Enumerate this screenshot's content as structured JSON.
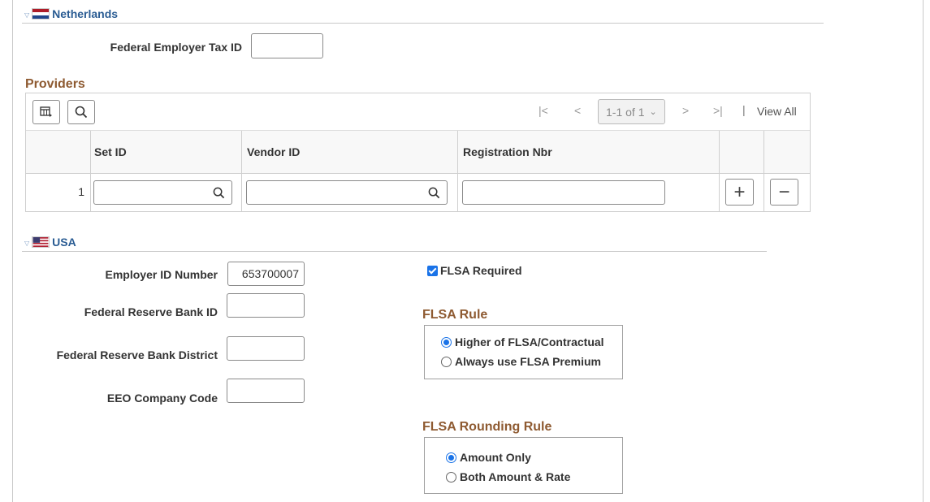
{
  "netherlands": {
    "title": "Netherlands",
    "fed_employer_tax_id_label": "Federal Employer Tax ID",
    "fed_employer_tax_id_value": ""
  },
  "providers": {
    "title": "Providers",
    "pager": {
      "range": "1-1 of 1",
      "view_all": "View All"
    },
    "columns": {
      "set_id": "Set ID",
      "vendor_id": "Vendor ID",
      "registration_nbr": "Registration Nbr"
    },
    "rows": [
      {
        "num": "1",
        "set_id": "",
        "vendor_id": "",
        "registration_nbr": ""
      }
    ],
    "add_symbol": "+",
    "delete_symbol": "−"
  },
  "usa": {
    "title": "USA",
    "employer_id_label": "Employer ID Number",
    "employer_id_value": "653700007",
    "frb_id_label": "Federal Reserve Bank ID",
    "frb_id_value": "",
    "frb_district_label": "Federal Reserve Bank District",
    "frb_district_value": "",
    "eeo_code_label": "EEO Company Code",
    "eeo_code_value": "",
    "flsa_required_label": "FLSA Required",
    "flsa_required_checked": true,
    "flsa_rule": {
      "title": "FLSA Rule",
      "options": [
        {
          "label": "Higher of FLSA/Contractual",
          "selected": true
        },
        {
          "label": "Always use FLSA Premium",
          "selected": false
        }
      ]
    },
    "flsa_rounding_rule": {
      "title": "FLSA Rounding Rule",
      "options": [
        {
          "label": "Amount Only",
          "selected": true
        },
        {
          "label": "Both Amount & Rate",
          "selected": false
        }
      ]
    }
  },
  "colors": {
    "section_header": "#2a5c93",
    "group_header": "#8e5a31",
    "accent": "#1a73e8"
  }
}
